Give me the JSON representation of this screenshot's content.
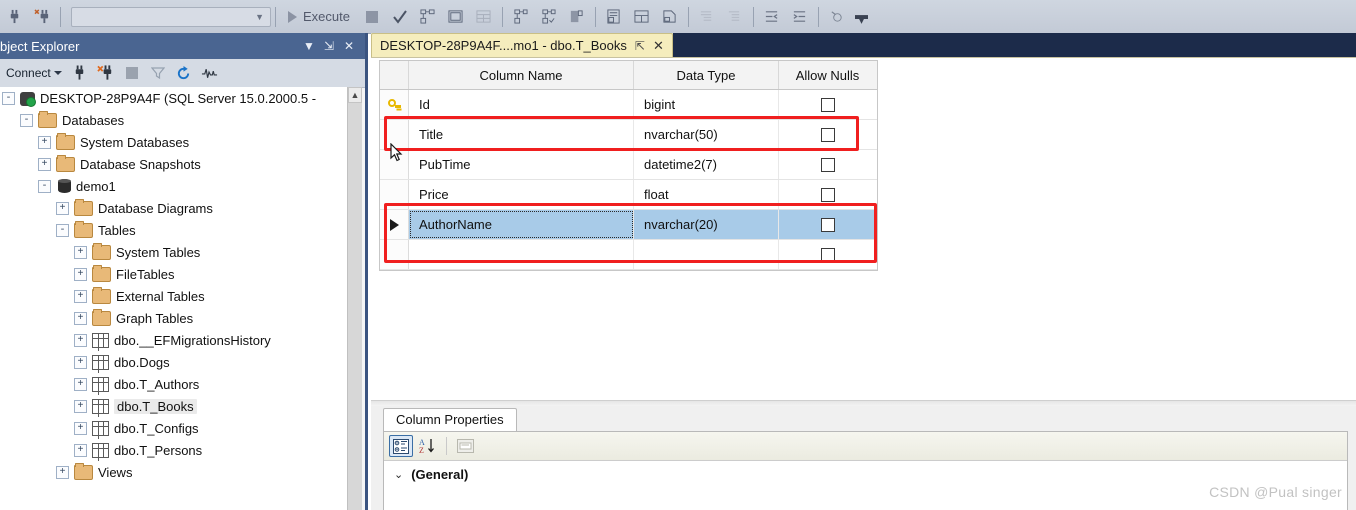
{
  "toolbar": {
    "combo_value": "",
    "execute_label": "Execute",
    "icons": [
      "connect-plug-icon",
      "disconnect-plug-icon",
      "stop-icon",
      "parse-check-icon",
      "display-estimated-plan-icon",
      "query-options-icon",
      "results-to-grid-icon",
      "include-actual-plan-icon",
      "include-live-stats-icon",
      "iec-icon",
      "results-to-text-icon",
      "results-to-grid2-icon",
      "results-to-file-icon",
      "comment-icon",
      "uncomment-icon",
      "decrease-indent-icon",
      "increase-indent-icon",
      "specify-values-icon"
    ]
  },
  "object_explorer": {
    "title": "bject Explorer",
    "title_buttons": [
      "chevron-down-icon",
      "pin-icon",
      "close-icon"
    ],
    "connect_label": "Connect",
    "toolbar_icons": [
      "connect-icon",
      "disconnect-icon",
      "stop-icon",
      "filter-icon",
      "refresh-icon",
      "activity-monitor-icon"
    ],
    "tree": [
      {
        "label": "DESKTOP-28P9A4F (SQL Server 15.0.2000.5 -",
        "indent": 0,
        "expander": "-",
        "icon": "server-icon",
        "selected": false
      },
      {
        "label": "Databases",
        "indent": 1,
        "expander": "-",
        "icon": "folder-icon",
        "selected": false
      },
      {
        "label": "System Databases",
        "indent": 2,
        "expander": "+",
        "icon": "folder-icon",
        "selected": false
      },
      {
        "label": "Database Snapshots",
        "indent": 2,
        "expander": "+",
        "icon": "folder-icon",
        "selected": false
      },
      {
        "label": "demo1",
        "indent": 2,
        "expander": "-",
        "icon": "database-icon",
        "selected": false
      },
      {
        "label": "Database Diagrams",
        "indent": 3,
        "expander": "+",
        "icon": "folder-icon",
        "selected": false
      },
      {
        "label": "Tables",
        "indent": 3,
        "expander": "-",
        "icon": "folder-icon",
        "selected": false
      },
      {
        "label": "System Tables",
        "indent": 4,
        "expander": "+",
        "icon": "folder-icon",
        "selected": false
      },
      {
        "label": "FileTables",
        "indent": 4,
        "expander": "+",
        "icon": "folder-icon",
        "selected": false
      },
      {
        "label": "External Tables",
        "indent": 4,
        "expander": "+",
        "icon": "folder-icon",
        "selected": false
      },
      {
        "label": "Graph Tables",
        "indent": 4,
        "expander": "+",
        "icon": "folder-icon",
        "selected": false
      },
      {
        "label": "dbo.__EFMigrationsHistory",
        "indent": 4,
        "expander": "+",
        "icon": "table-icon",
        "selected": false
      },
      {
        "label": "dbo.Dogs",
        "indent": 4,
        "expander": "+",
        "icon": "table-icon",
        "selected": false
      },
      {
        "label": "dbo.T_Authors",
        "indent": 4,
        "expander": "+",
        "icon": "table-icon",
        "selected": false
      },
      {
        "label": "dbo.T_Books",
        "indent": 4,
        "expander": "+",
        "icon": "table-icon",
        "selected": true
      },
      {
        "label": "dbo.T_Configs",
        "indent": 4,
        "expander": "+",
        "icon": "table-icon",
        "selected": false
      },
      {
        "label": "dbo.T_Persons",
        "indent": 4,
        "expander": "+",
        "icon": "table-icon",
        "selected": false
      },
      {
        "label": "Views",
        "indent": 3,
        "expander": "+",
        "icon": "folder-icon",
        "selected": false
      }
    ]
  },
  "document": {
    "tab_label": "DESKTOP-28P9A4F....mo1 - dbo.T_Books",
    "tab_pin_icon": "pin-icon",
    "tab_close_icon": "close-icon",
    "grid": {
      "headers": [
        "Column Name",
        "Data Type",
        "Allow Nulls"
      ],
      "rows": [
        {
          "name": "Id",
          "type": "bigint",
          "allow_nulls": false,
          "key": true,
          "selected": false,
          "current": false
        },
        {
          "name": "Title",
          "type": "nvarchar(50)",
          "allow_nulls": false,
          "key": false,
          "selected": false,
          "current": false
        },
        {
          "name": "PubTime",
          "type": "datetime2(7)",
          "allow_nulls": false,
          "key": false,
          "selected": false,
          "current": false
        },
        {
          "name": "Price",
          "type": "float",
          "allow_nulls": false,
          "key": false,
          "selected": false,
          "current": false
        },
        {
          "name": "AuthorName",
          "type": "nvarchar(20)",
          "allow_nulls": false,
          "key": false,
          "selected": true,
          "current": true
        },
        {
          "name": "",
          "type": "",
          "allow_nulls": false,
          "key": false,
          "selected": false,
          "current": false
        }
      ]
    }
  },
  "properties": {
    "tab_label": "Column Properties",
    "toolbar_icons": [
      "categorized-icon",
      "alphabetical-sort-icon",
      "property-pages-icon"
    ],
    "group_label": "(General)",
    "chevron_icon": "chevron-down-icon"
  },
  "annotations": {
    "highlight_color": "#f01f1f",
    "boxes": [
      "title-row-highlight",
      "authorname-row-highlight"
    ]
  },
  "watermark": "CSDN @Pual singer"
}
